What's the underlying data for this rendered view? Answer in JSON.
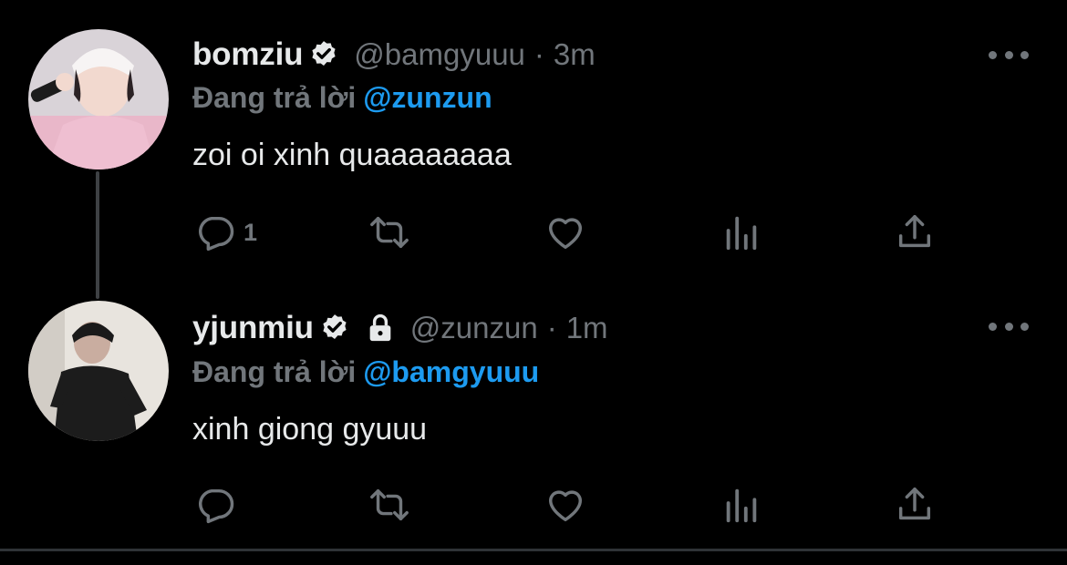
{
  "tweets": [
    {
      "display_name": "bomziu",
      "verified": true,
      "locked": false,
      "handle": "@bamgyuuu",
      "separator": "·",
      "time": "3m",
      "reply_prefix": "Đang trả lời",
      "reply_to": "@zunzun",
      "text": "zoi oi xinh quaaaaaaaa",
      "reply_count": "1",
      "avatar_icon": "avatar-photo"
    },
    {
      "display_name": "yjunmiu",
      "verified": true,
      "locked": true,
      "handle": "@zunzun",
      "separator": "·",
      "time": "1m",
      "reply_prefix": "Đang trả lời",
      "reply_to": "@bamgyuuu",
      "text": "xinh giong gyuuu",
      "reply_count": "",
      "avatar_icon": "avatar-photo"
    }
  ],
  "icons": {
    "reply": "speech-bubble-icon",
    "retweet": "retweet-icon",
    "like": "heart-icon",
    "views": "bar-chart-icon",
    "share": "share-icon",
    "more": "more-dots-icon",
    "verified": "verified-badge-icon",
    "lock": "lock-icon"
  },
  "colors": {
    "background": "#000000",
    "primary_text": "#e7e9ea",
    "secondary_text": "#71767b",
    "accent": "#1d9bf0",
    "divider": "#2f3336"
  }
}
